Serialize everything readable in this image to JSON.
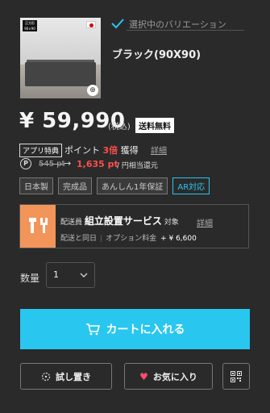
{
  "product": {
    "thumb_tag": "正方形\n90×90",
    "selected_label": "選択中のバリエーション",
    "variation_name": "ブラック(90X90)"
  },
  "price": {
    "amount": "¥ 59,990",
    "tax": "(税込)",
    "shipping_badge": "送料無料"
  },
  "points": {
    "app_badge": "アプリ特典",
    "prefix": "ポイント",
    "multiplier": "3倍",
    "suffix": "獲得",
    "detail_link": "詳細",
    "p_symbol": "P",
    "old": "545 pt",
    "arrow": "→",
    "new": "1,635 pt",
    "per_yen": "/ 円相当還元"
  },
  "tags": [
    "日本製",
    "完成品",
    "あんしん1年保証",
    "AR対応"
  ],
  "assembly": {
    "prefix": "配送員",
    "title": "組立設置サービス",
    "suffix": "対象",
    "detail_link": "詳細",
    "sub1": "配送と同日",
    "sub2": "オプション料金",
    "fee": "+ ¥ 6,600"
  },
  "quantity": {
    "label": "数量",
    "value": "1"
  },
  "actions": {
    "cart": "カートに入れる",
    "try": "試し置き",
    "favorite": "お気に入り"
  },
  "colors": {
    "accent": "#29c6f0",
    "points_red": "#ff4d4d",
    "assembly_orange": "#f2955a",
    "background": "#2a2a2a"
  }
}
